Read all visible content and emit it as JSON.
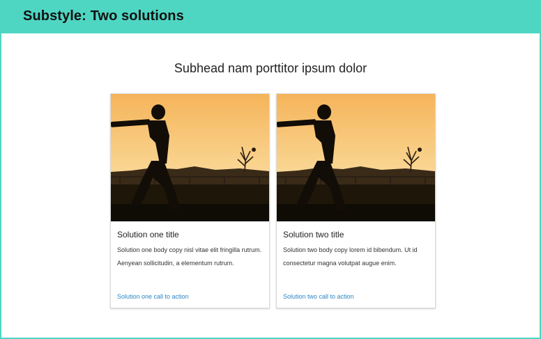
{
  "banner": {
    "title": "Substyle: Two solutions"
  },
  "subhead": "Subhead nam porttitor ipsum dolor",
  "solutions": [
    {
      "title": "Solution one title",
      "body": "Solution one body copy nisl vitae elit fringilla rutrum. Aenyean sollicitudin, a elementum rutrum.",
      "cta": "Solution one call to action"
    },
    {
      "title": "Solution two title",
      "body": "Solution two body copy lorem id bibendum. Ut id consectetur magna volutpat augue enim.",
      "cta": "Solution two call to action"
    }
  ],
  "colors": {
    "accent": "#4fd6c3",
    "link": "#2a86c5"
  }
}
